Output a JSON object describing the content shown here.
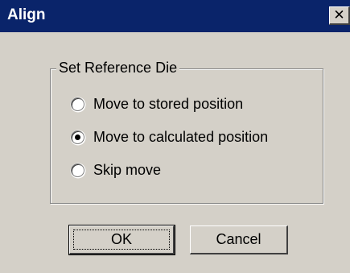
{
  "window": {
    "title": "Align",
    "close_label": "✕"
  },
  "group": {
    "label": "Set Reference Die",
    "options": [
      {
        "label": "Move to stored position",
        "selected": false
      },
      {
        "label": "Move to calculated position",
        "selected": true
      },
      {
        "label": "Skip move",
        "selected": false
      }
    ]
  },
  "buttons": {
    "ok_label": "OK",
    "cancel_label": "Cancel"
  },
  "colors": {
    "titlebar": "#0a246a",
    "face": "#d4d0c8"
  }
}
